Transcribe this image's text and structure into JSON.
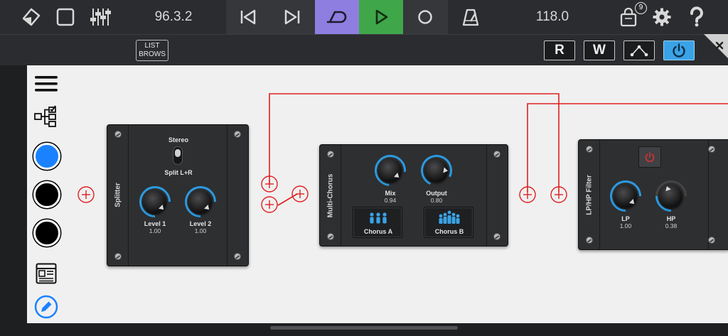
{
  "topbar": {
    "position_readout": "96.3.2",
    "tempo_readout": "118.0",
    "store_badge": "9",
    "icons": [
      "view-cube-icon",
      "stop-square-icon",
      "mixer-icon",
      "skip-back-icon",
      "skip-forward-icon",
      "loop-icon",
      "play-icon",
      "record-icon",
      "metronome-icon",
      "store-bag-icon",
      "gear-icon",
      "help-icon"
    ],
    "colors": {
      "loop_bg": "#8e7ee0",
      "play_bg": "#3fa64a"
    }
  },
  "toolbar2": {
    "list_browse_line1": "LIST",
    "list_browse_line2": "BROWS",
    "read_label": "R",
    "write_label": "W",
    "power_color": "#3aa3e6"
  },
  "palette": {
    "items": [
      "menu-icon",
      "tree-checklist-icon",
      "blue-circle-icon",
      "black-circle-icon",
      "black-circle-icon",
      "window-panel-icon",
      "pencil-icon"
    ],
    "accent": "#1a82ff"
  },
  "splitter": {
    "title": "Splitter",
    "mode_label_top": "Stereo",
    "mode_label_bottom": "Split L+R",
    "knobs": [
      {
        "label": "Level 1",
        "value": "1.00"
      },
      {
        "label": "Level 2",
        "value": "1.00"
      }
    ]
  },
  "chorus": {
    "title": "Multi-Chorus",
    "knobs": [
      {
        "label": "Mix",
        "value": "0.94"
      },
      {
        "label": "Output",
        "value": "0.80"
      }
    ],
    "buttons": [
      "Chorus A",
      "Chorus B"
    ]
  },
  "filter": {
    "title": "LP/HP Filter",
    "knobs": [
      {
        "label": "LP",
        "value": "1.00"
      },
      {
        "label": "HP",
        "value": "0.38"
      }
    ]
  },
  "wire_color": "#e02020"
}
